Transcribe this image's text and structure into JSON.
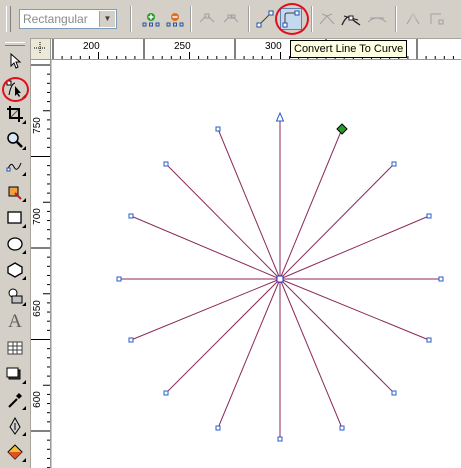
{
  "propbar": {
    "shape_select": {
      "value": "Rectangular",
      "icon": "chevron-down-icon"
    },
    "tools": [
      {
        "name": "add-node-button",
        "icon": "add-node-icon"
      },
      {
        "name": "delete-node-button",
        "icon": "delete-node-icon"
      },
      {
        "name": "join-nodes-button",
        "icon": "join-nodes-icon"
      },
      {
        "name": "break-curve-button",
        "icon": "break-curve-icon"
      },
      {
        "name": "convert-curve-to-line-button",
        "icon": "line-icon"
      },
      {
        "name": "convert-line-to-curve-button",
        "icon": "curve-icon"
      },
      {
        "name": "make-node-cusp-button",
        "icon": "cusp-icon"
      },
      {
        "name": "make-node-smooth-button",
        "icon": "smooth-icon"
      },
      {
        "name": "make-node-symmetrical-button",
        "icon": "symmetrical-icon"
      }
    ]
  },
  "tooltip": {
    "text": "Convert Line To Curve"
  },
  "rulers": {
    "horizontal_labels": [
      "200",
      "250",
      "300"
    ],
    "vertical_labels": [
      "750",
      "700",
      "650",
      "600"
    ]
  },
  "toolbox": {
    "tools": [
      {
        "name": "pick-tool",
        "icon": "arrow-pointer-icon"
      },
      {
        "name": "shape-tool",
        "icon": "shape-tool-icon"
      },
      {
        "name": "crop-tool",
        "icon": "crop-icon"
      },
      {
        "name": "zoom-tool",
        "icon": "magnifier-icon"
      },
      {
        "name": "freehand-tool",
        "icon": "freehand-icon"
      },
      {
        "name": "smart-fill-tool",
        "icon": "smart-fill-icon"
      },
      {
        "name": "rectangle-tool",
        "icon": "rectangle-icon"
      },
      {
        "name": "ellipse-tool",
        "icon": "ellipse-icon"
      },
      {
        "name": "polygon-tool",
        "icon": "polygon-icon"
      },
      {
        "name": "basic-shapes-tool",
        "icon": "basic-shapes-icon"
      },
      {
        "name": "text-tool",
        "icon": "text-icon",
        "glyph": "A"
      },
      {
        "name": "table-tool",
        "icon": "table-icon"
      },
      {
        "name": "interactive-tool",
        "icon": "interactive-icon"
      },
      {
        "name": "eyedropper-tool",
        "icon": "eyedropper-icon"
      },
      {
        "name": "outline-tool",
        "icon": "outline-pen-icon"
      },
      {
        "name": "fill-tool",
        "icon": "fill-bucket-icon"
      }
    ]
  },
  "colors": {
    "highlight_circle": "#e0101a",
    "line": "#8b2a5a",
    "node": "#2a5cc8",
    "selected_node": "#2a9a2a",
    "tooltip_bg": "#ffffe1"
  }
}
